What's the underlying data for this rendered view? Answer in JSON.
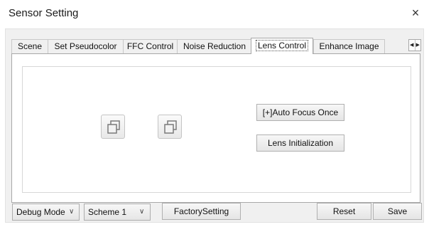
{
  "window": {
    "title": "Sensor Setting",
    "close_glyph": "×"
  },
  "tabs": [
    {
      "label": "Scene"
    },
    {
      "label": "Set Pseudocolor"
    },
    {
      "label": "FFC Control"
    },
    {
      "label": "Noise Reduction"
    },
    {
      "label": "Lens Control",
      "active": true
    },
    {
      "label": "Enhance Image"
    }
  ],
  "tab_scroller": {
    "left_glyph": "◀",
    "right_glyph": "▶"
  },
  "lens_panel": {
    "icon_buttons": [
      {
        "icon": "copy-icon"
      },
      {
        "icon": "copy-icon"
      }
    ],
    "auto_focus_label": "[+]Auto Focus Once",
    "lens_init_label": "Lens Initialization"
  },
  "footer": {
    "mode_select_value": "Debug Mode",
    "scheme_select_value": "Scheme 1",
    "chevron_glyph": "∨",
    "factory_label": "FactorySetting",
    "reset_label": "Reset",
    "save_label": "Save"
  }
}
